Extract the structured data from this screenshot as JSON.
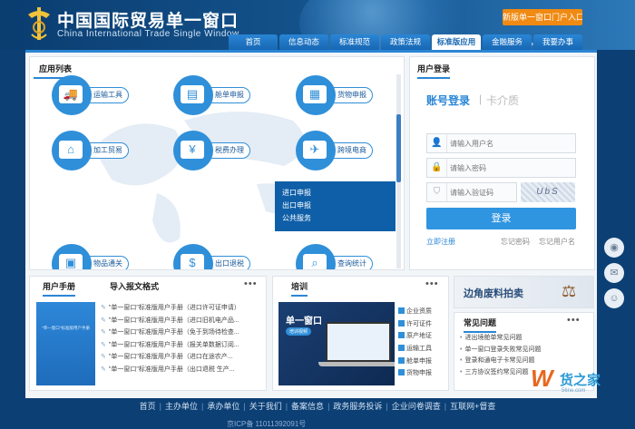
{
  "header": {
    "title_cn": "中国国际贸易单一窗口",
    "title_en": "China International Trade Single Window",
    "entry_button": "新版单一窗口门户入口",
    "nav": [
      "首页",
      "信息动态",
      "标准规范",
      "政策法规",
      "标准版应用",
      "金融服务",
      "我要办事"
    ],
    "active_nav": "标准版应用"
  },
  "apps": {
    "title": "应用列表",
    "items": [
      {
        "label": "运输工具",
        "icon": "truck-icon",
        "glyph": "🚚"
      },
      {
        "label": "舱单申报",
        "icon": "manifest-icon",
        "glyph": "▤"
      },
      {
        "label": "货物申报",
        "icon": "cargo-icon",
        "glyph": "▦"
      },
      {
        "label": "加工贸易",
        "icon": "factory-icon",
        "glyph": "⌂"
      },
      {
        "label": "税费办理",
        "icon": "tax-icon",
        "glyph": "¥"
      },
      {
        "label": "跨境电商",
        "icon": "ecommerce-icon",
        "glyph": "✈"
      },
      {
        "label": "物品通关",
        "icon": "package-icon",
        "glyph": "▣"
      },
      {
        "label": "出口退税",
        "icon": "refund-icon",
        "glyph": "$"
      },
      {
        "label": "查询统计",
        "icon": "query-icon",
        "glyph": "⌕"
      }
    ],
    "popup": [
      "进口申报",
      "出口申报",
      "公共服务"
    ]
  },
  "login": {
    "title": "用户登录",
    "tab_account": "账号登录",
    "tab_separator": "|",
    "tab_card": "卡介质",
    "username_placeholder": "请输入用户名",
    "password_placeholder": "请输入密码",
    "captcha_placeholder": "请输入验证码",
    "captcha_text": "UbS",
    "login_button": "登录",
    "register": "立即注册",
    "forgot_password": "忘记密码",
    "forgot_username": "忘记用户名"
  },
  "manual": {
    "tab_manual": "用户手册",
    "tab_format": "导入报文格式",
    "more": "•••",
    "cover_text": "\"单一窗口\"标准版用户手册",
    "items": [
      "\"单一窗口\"标准版用户手册（进口许可证申请）",
      "\"单一窗口\"标准版用户手册（进口旧机电产品...",
      "\"单一窗口\"标准版用户手册（免于到场待检查...",
      "\"单一窗口\"标准版用户手册（报关单数据订阅...",
      "\"单一窗口\"标准版用户手册（进口在途农产...",
      "\"单一窗口\"标准版用户手册（出口退税 生产..."
    ]
  },
  "training": {
    "title": "培训",
    "more": "•••",
    "image_title": "单一窗口",
    "image_badge": "培训视频",
    "items": [
      "企业资质",
      "许可证件",
      "原产地证",
      "运输工具",
      "舱单申报",
      "货物申报"
    ]
  },
  "promo": {
    "text": "边角废料拍卖"
  },
  "faq": {
    "title": "常见问题",
    "more": "•••",
    "items": [
      "进出境舱单常见问题",
      "单一窗口登录失败常见问题",
      "登录和通电子卡常见问题",
      "三方协议签约常见问题"
    ]
  },
  "footer": {
    "links": [
      "首页",
      "主办单位",
      "承办单位",
      "关于我们",
      "备案信息",
      "政务服务投诉",
      "企业问卷调查",
      "互联网+督查"
    ],
    "icp": "京ICP备 11011392091号"
  },
  "social": [
    "weibo-icon",
    "wechat-icon",
    "feedback-icon"
  ],
  "watermark": {
    "logo": "W",
    "text": "货之家",
    "url": "56ne.com"
  },
  "colors": {
    "header_bg": "#0c3f74",
    "accent": "#2a86d6",
    "entry_button": "#f08a12",
    "promo_text": "#2a4e79"
  }
}
